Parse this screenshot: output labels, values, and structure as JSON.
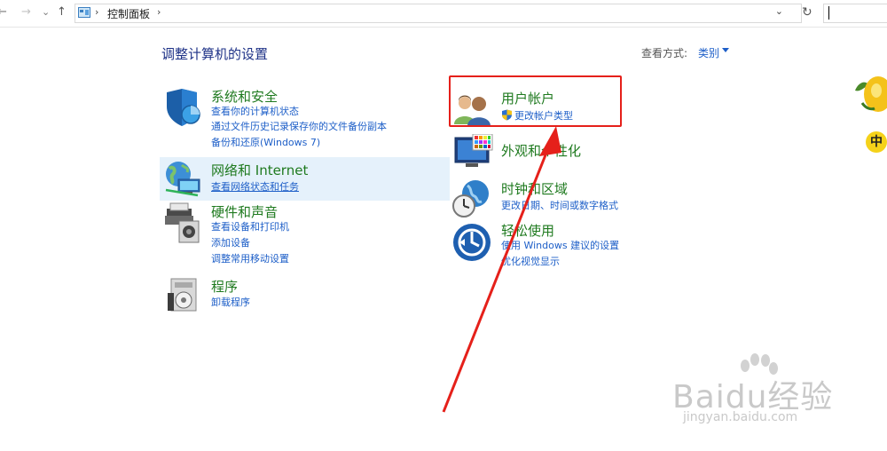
{
  "address_bar": {
    "back_glyph": "←",
    "forward_glyph": "→",
    "history_glyph": "⌄",
    "up_glyph": "↑",
    "separator": "›",
    "path": "控制面板",
    "dropdown_glyph": "⌄",
    "refresh_glyph": "↻"
  },
  "header": {
    "title": "调整计算机的设置",
    "view_by_label": "查看方式:",
    "view_by_value": "类别"
  },
  "categories_left": [
    {
      "title": "系统和安全",
      "links": [
        "查看你的计算机状态",
        "通过文件历史记录保存你的文件备份副本",
        "备份和还原(Windows 7)"
      ]
    },
    {
      "title": "网络和 Internet",
      "links": [
        "查看网络状态和任务"
      ]
    },
    {
      "title": "硬件和声音",
      "links": [
        "查看设备和打印机",
        "添加设备",
        "调整常用移动设置"
      ]
    },
    {
      "title": "程序",
      "links": [
        "卸载程序"
      ]
    }
  ],
  "categories_right": [
    {
      "title": "用户帐户",
      "links": [
        "更改帐户类型"
      ]
    },
    {
      "title": "外观和个性化",
      "links": []
    },
    {
      "title": "时钟和区域",
      "links": [
        "更改日期、时间或数字格式"
      ]
    },
    {
      "title": "轻松使用",
      "links": [
        "使用 Windows 建议的设置",
        "优化视觉显示"
      ]
    }
  ],
  "watermark": {
    "main": "Baidu经验",
    "sub": "jingyan.baidu.com"
  },
  "ime_badge": "中",
  "colors": {
    "accent": "#1e5fc8",
    "title_green": "#1f7a1f",
    "annotation_red": "#e5201a"
  }
}
